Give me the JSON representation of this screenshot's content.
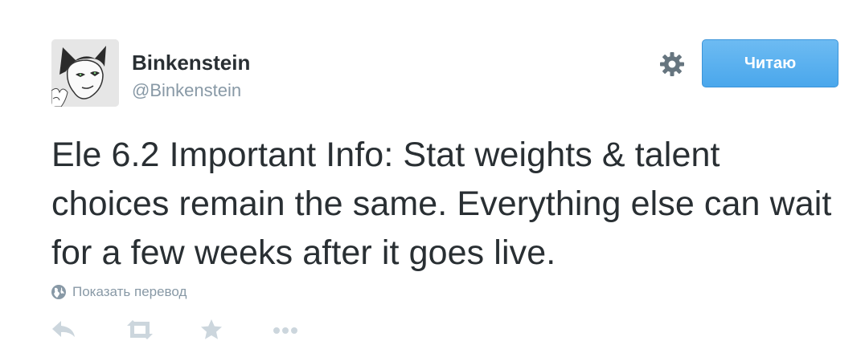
{
  "user": {
    "display_name": "Binkenstein",
    "screen_name": "@Binkenstein"
  },
  "follow_button": {
    "label": "Читаю"
  },
  "tweet": {
    "text": "Ele 6.2 Important Info: Stat weights & talent choices remain the same. Everything else can wait for a few weeks after it goes live."
  },
  "translate": {
    "label": "Показать перевод",
    "icon": "globe-icon"
  },
  "actions": {
    "icons": [
      "reply-icon",
      "retweet-icon",
      "favorite-icon",
      "more-icon"
    ]
  },
  "colors": {
    "text": "#292f33",
    "muted": "#8899a6",
    "button_blue": "#55acee",
    "icon_gray": "#ccd6dd"
  }
}
